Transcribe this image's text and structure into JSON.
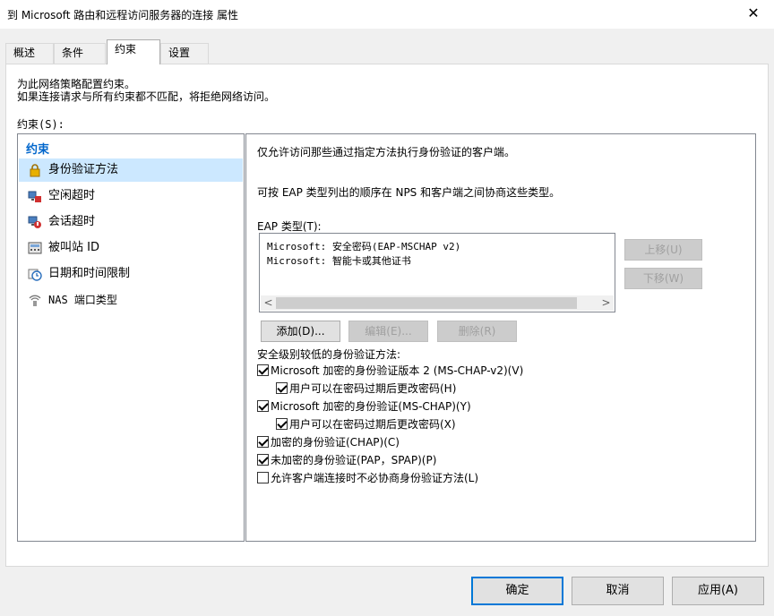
{
  "window": {
    "title": "到 Microsoft 路由和远程访问服务器的连接 属性",
    "close_glyph": "✕"
  },
  "tabs": [
    {
      "label": "概述"
    },
    {
      "label": "条件"
    },
    {
      "label": "约束",
      "active": true
    },
    {
      "label": "设置"
    }
  ],
  "panel": {
    "intro_line1": "为此网络策略配置约束。",
    "intro_line2": "如果连接请求与所有约束都不匹配，将拒绝网络访问。",
    "constraints_label": "约束(S):"
  },
  "constraints": {
    "header": "约束",
    "items": [
      {
        "label": "身份验证方法",
        "icon": "lock-icon",
        "selected": true
      },
      {
        "label": "空闲超时",
        "icon": "idle-timeout-icon"
      },
      {
        "label": "会话超时",
        "icon": "session-timeout-icon"
      },
      {
        "label": "被叫站 ID",
        "icon": "called-station-icon"
      },
      {
        "label": "日期和时间限制",
        "icon": "clock-icon"
      },
      {
        "label": "NAS 端口类型",
        "icon": "wireless-icon"
      }
    ]
  },
  "auth": {
    "desc1": "仅允许访问那些通过指定方法执行身份验证的客户端。",
    "desc2": "可按 EAP 类型列出的顺序在 NPS 和客户端之间协商这些类型。",
    "eap_label": "EAP 类型(T):",
    "eap_items": [
      "Microsoft: 安全密码(EAP-MSCHAP v2)",
      "Microsoft: 智能卡或其他证书"
    ],
    "move_up": "上移(U)",
    "move_down": "下移(W)",
    "add": "添加(D)...",
    "edit": "编辑(E)...",
    "remove": "删除(R)",
    "less_secure_label": "安全级别较低的身份验证方法:",
    "options": [
      {
        "label": "Microsoft 加密的身份验证版本 2 (MS-CHAP-v2)(V)",
        "checked": true
      },
      {
        "label": "用户可以在密码过期后更改密码(H)",
        "checked": true
      },
      {
        "label": "Microsoft 加密的身份验证(MS-CHAP)(Y)",
        "checked": true
      },
      {
        "label": "用户可以在密码过期后更改密码(X)",
        "checked": true
      },
      {
        "label": "加密的身份验证(CHAP)(C)",
        "checked": true
      },
      {
        "label": "未加密的身份验证(PAP，SPAP)(P)",
        "checked": true
      },
      {
        "label": "允许客户端连接时不必协商身份验证方法(L)",
        "checked": false
      }
    ]
  },
  "footer": {
    "ok": "确定",
    "cancel": "取消",
    "apply": "应用(A)"
  }
}
